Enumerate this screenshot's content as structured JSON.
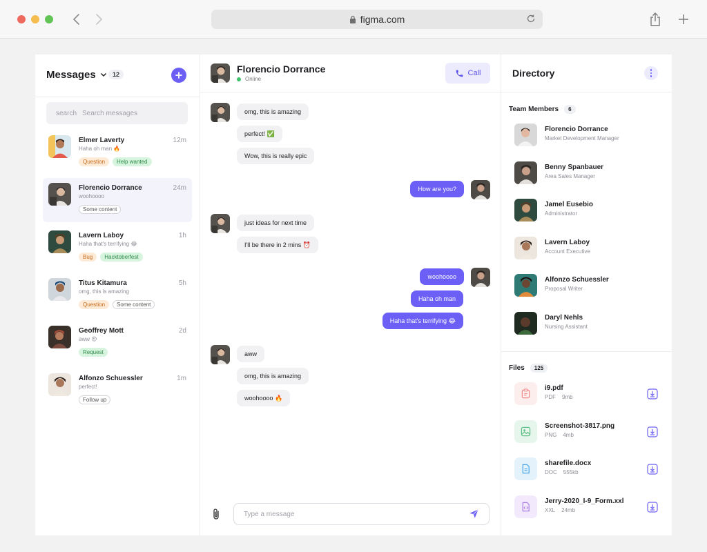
{
  "browser": {
    "url": "figma.com"
  },
  "colors": {
    "accent": "#6b5ff5",
    "online": "#3fc26b"
  },
  "left": {
    "title": "Messages",
    "count": "12",
    "search": {
      "label": "search",
      "placeholder": "Search messages"
    },
    "conversations": [
      {
        "name": "Elmer Laverty",
        "time": "12m",
        "preview": "Haha oh man 🔥",
        "tags": [
          "Question",
          "Help wanted"
        ]
      },
      {
        "name": "Florencio Dorrance",
        "time": "24m",
        "preview": "woohoooo",
        "tags": [
          "Some content"
        ]
      },
      {
        "name": "Lavern Laboy",
        "time": "1h",
        "preview": "Haha that's terrifying 😂",
        "tags": [
          "Bug",
          "Hacktoberfest"
        ]
      },
      {
        "name": "Titus Kitamura",
        "time": "5h",
        "preview": "omg, this is amazing",
        "tags": [
          "Question",
          "Some content"
        ]
      },
      {
        "name": "Geoffrey Mott",
        "time": "2d",
        "preview": "aww 😍",
        "tags": [
          "Request"
        ]
      },
      {
        "name": "Alfonzo Schuessler",
        "time": "1m",
        "preview": "perfect!",
        "tags": [
          "Follow up"
        ]
      }
    ]
  },
  "chat": {
    "contact": "Florencio Dorrance",
    "status": "Online",
    "call_label": "Call",
    "messages": [
      {
        "dir": "in",
        "text": "omg, this is amazing"
      },
      {
        "dir": "in",
        "text": "perfect! ✅"
      },
      {
        "dir": "in",
        "text": "Wow, this is really epic"
      },
      {
        "dir": "out",
        "text": "How are you?"
      },
      {
        "dir": "in",
        "text": "just ideas for next time"
      },
      {
        "dir": "in",
        "text": "I'll be there in 2 mins ⏰"
      },
      {
        "dir": "out",
        "text": "woohoooo"
      },
      {
        "dir": "out",
        "text": "Haha oh man"
      },
      {
        "dir": "out",
        "text": "Haha that's terrifying 😂"
      },
      {
        "dir": "in",
        "text": "aww"
      },
      {
        "dir": "in",
        "text": "omg, this is amazing"
      },
      {
        "dir": "in",
        "text": "woohoooo 🔥"
      }
    ],
    "input_placeholder": "Type a message"
  },
  "directory": {
    "title": "Directory",
    "team_label": "Team Members",
    "team_count": "6",
    "members": [
      {
        "name": "Florencio Dorrance",
        "role": "Market Development Manager"
      },
      {
        "name": "Benny Spanbauer",
        "role": "Area Sales Manager"
      },
      {
        "name": "Jamel Eusebio",
        "role": "Administrator"
      },
      {
        "name": "Lavern Laboy",
        "role": "Account Executive"
      },
      {
        "name": "Alfonzo Schuessler",
        "role": "Proposal Writer"
      },
      {
        "name": "Daryl Nehls",
        "role": "Nursing Assistant"
      }
    ],
    "files_label": "Files",
    "files_count": "125",
    "files": [
      {
        "name": "i9.pdf",
        "type": "PDF",
        "size": "9mb",
        "icon": "pdf-file-icon",
        "color": "#f08a8a"
      },
      {
        "name": "Screenshot-3817.png",
        "type": "PNG",
        "size": "4mb",
        "icon": "image-file-icon",
        "color": "#5cc084"
      },
      {
        "name": "sharefile.docx",
        "type": "DOC",
        "size": "555kb",
        "icon": "doc-file-icon",
        "color": "#4aa6e6"
      },
      {
        "name": "Jerry-2020_I-9_Form.xxl",
        "type": "XXL",
        "size": "24mb",
        "icon": "code-file-icon",
        "color": "#a97ee6"
      }
    ]
  }
}
